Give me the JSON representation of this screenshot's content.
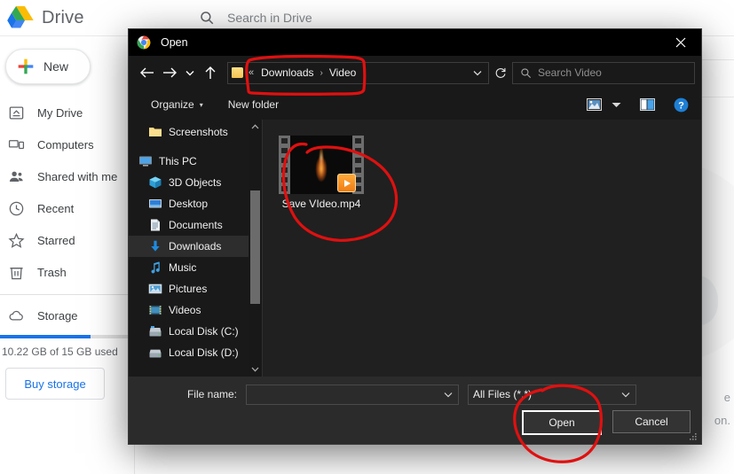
{
  "drive": {
    "brand": "Drive",
    "logo_icon": "google-drive-logo",
    "search": {
      "icon": "search-icon",
      "placeholder": "Search in Drive",
      "value": ""
    },
    "new_button": {
      "label": "New",
      "icon": "plus-icon"
    },
    "nav_items": [
      {
        "label": "My Drive",
        "icon": "my-drive-icon"
      },
      {
        "label": "Computers",
        "icon": "computers-icon"
      },
      {
        "label": "Shared with me",
        "icon": "people-icon"
      },
      {
        "label": "Recent",
        "icon": "clock-icon"
      },
      {
        "label": "Starred",
        "icon": "star-icon"
      },
      {
        "label": "Trash",
        "icon": "trash-icon"
      }
    ],
    "storage": {
      "label": "Storage",
      "icon": "cloud-icon",
      "used_text": "10.22 GB of 15 GB used",
      "percent": 68,
      "bar_color": "#1a73e8",
      "buy_label": "Buy storage"
    },
    "background_texts": {
      "line1": "e",
      "line2": "on."
    }
  },
  "dialog": {
    "title": "Open",
    "app_icon": "chrome-icon",
    "close_icon": "close-icon",
    "nav": {
      "back_icon": "arrow-left-icon",
      "forward_icon": "arrow-right-icon",
      "recent_icon": "chevron-down-icon",
      "up_icon": "arrow-up-icon",
      "refresh_icon": "refresh-icon",
      "address_dropdown_icon": "chevron-down-icon",
      "folder_icon": "folder-icon",
      "overflow": "«",
      "breadcrumbs": [
        "Downloads",
        "Video"
      ],
      "separator": "›"
    },
    "search": {
      "icon": "search-icon",
      "placeholder": "Search Video",
      "value": ""
    },
    "toolbar": {
      "organize_label": "Organize",
      "organize_caret": "▾",
      "new_folder_label": "New folder",
      "view_icon": "view-options-icon",
      "view_caret_icon": "chevron-down-icon",
      "preview_pane_icon": "preview-pane-icon",
      "help_icon": "help-icon",
      "help_glyph": "?"
    },
    "nav_pane": {
      "items": [
        {
          "label": "Screenshots",
          "icon": "folder-icon",
          "indent": 1,
          "selected": false
        },
        {
          "label": "This PC",
          "icon": "this-pc-icon",
          "indent": 0,
          "selected": false
        },
        {
          "label": "3D Objects",
          "icon": "3d-objects-icon",
          "indent": 1,
          "selected": false
        },
        {
          "label": "Desktop",
          "icon": "desktop-icon",
          "indent": 1,
          "selected": false
        },
        {
          "label": "Documents",
          "icon": "documents-icon",
          "indent": 1,
          "selected": false
        },
        {
          "label": "Downloads",
          "icon": "downloads-icon",
          "indent": 1,
          "selected": true
        },
        {
          "label": "Music",
          "icon": "music-icon",
          "indent": 1,
          "selected": false
        },
        {
          "label": "Pictures",
          "icon": "pictures-icon",
          "indent": 1,
          "selected": false
        },
        {
          "label": "Videos",
          "icon": "videos-icon",
          "indent": 1,
          "selected": false
        },
        {
          "label": "Local Disk (C:)",
          "icon": "local-disk-c-icon",
          "indent": 1,
          "selected": false
        },
        {
          "label": "Local Disk (D:)",
          "icon": "local-disk-d-icon",
          "indent": 1,
          "selected": false
        }
      ],
      "scroll_up_icon": "chevron-up-icon",
      "scroll_down_icon": "chevron-down-icon"
    },
    "files": [
      {
        "name": "Save VIdeo.mp4",
        "icon": "video-file-icon",
        "badge": "play-badge-icon"
      }
    ],
    "footer": {
      "filename_label": "File name:",
      "filename_value": "",
      "filename_caret_icon": "chevron-down-icon",
      "filetype_value": "All Files (*.*)",
      "filetype_caret_icon": "chevron-down-icon",
      "open_label": "Open",
      "cancel_label": "Cancel",
      "resize_grip_icon": "resize-grip-icon"
    }
  },
  "annotations": {
    "color": "#e01010",
    "marks": [
      {
        "name": "address-bar-highlight",
        "shape": "rounded-rect"
      },
      {
        "name": "file-item-highlight",
        "shape": "ellipse"
      },
      {
        "name": "open-button-highlight",
        "shape": "ellipse"
      }
    ]
  }
}
